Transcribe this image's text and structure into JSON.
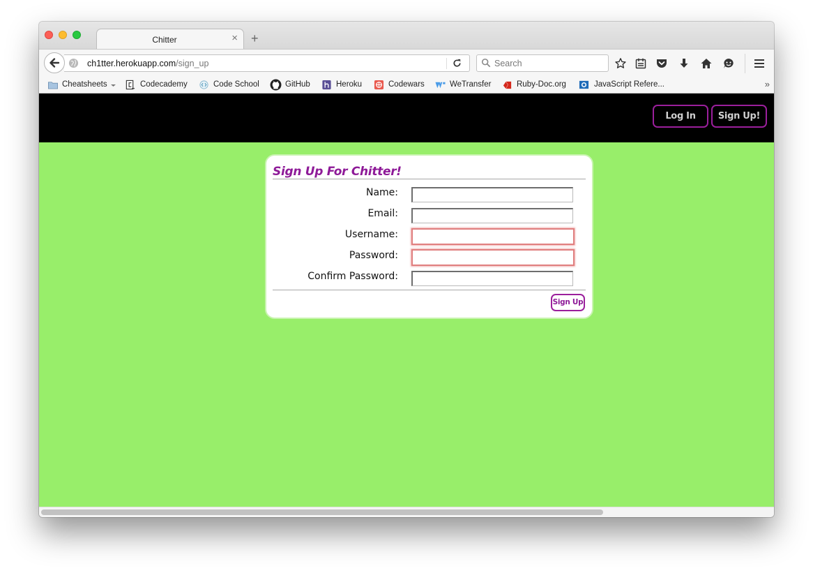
{
  "browser": {
    "tab_title": "Chitter",
    "tab_close": "×",
    "new_tab": "+",
    "url_host": "ch1tter.herokuapp.com",
    "url_path": "/sign_up",
    "search_placeholder": "Search",
    "bookmarks": [
      {
        "label": "Cheatsheets",
        "icon": "folder-icon"
      },
      {
        "label": "Codecademy",
        "icon": "codecademy-icon"
      },
      {
        "label": "Code School",
        "icon": "codeschool-icon"
      },
      {
        "label": "GitHub",
        "icon": "github-icon"
      },
      {
        "label": "Heroku",
        "icon": "heroku-icon"
      },
      {
        "label": "Codewars",
        "icon": "codewars-icon"
      },
      {
        "label": "WeTransfer",
        "icon": "wetransfer-icon"
      },
      {
        "label": "Ruby-Doc.org",
        "icon": "rubydoc-icon"
      },
      {
        "label": "JavaScript Refere...",
        "icon": "mdn-icon"
      }
    ],
    "bookmarks_more": "»",
    "toolbar_icons": [
      "star-icon",
      "reading-list-icon",
      "pocket-icon",
      "download-icon",
      "home-icon",
      "hello-icon",
      "hamburger-menu-icon"
    ]
  },
  "site": {
    "login_label": "Log In",
    "signup_label": "Sign Up!"
  },
  "form": {
    "title": "Sign Up For Chitter!",
    "fields": [
      {
        "label": "Name:",
        "value": "",
        "invalid": false
      },
      {
        "label": "Email:",
        "value": "",
        "invalid": false
      },
      {
        "label": "Username:",
        "value": "",
        "invalid": true
      },
      {
        "label": "Password:",
        "value": "",
        "invalid": true
      },
      {
        "label": "Confirm Password:",
        "value": "",
        "invalid": false
      }
    ],
    "submit_label": "Sign Up"
  },
  "colors": {
    "page_background": "#98ee6a",
    "header_background": "#000000",
    "accent_purple": "#9b1f9c",
    "invalid_border": "#e07f7f"
  }
}
